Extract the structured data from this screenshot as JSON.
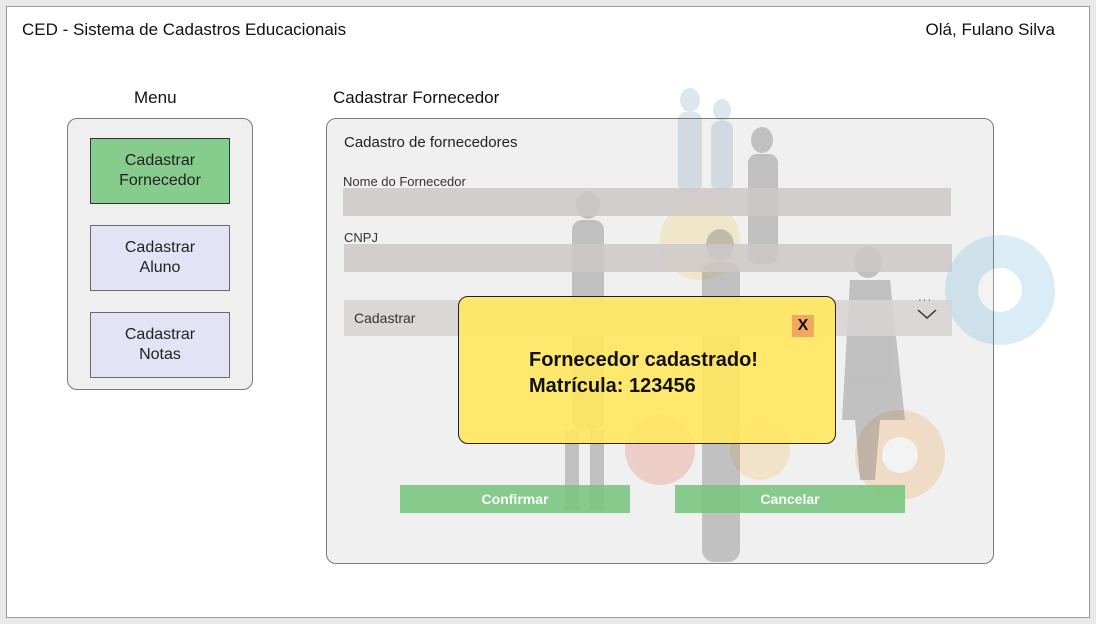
{
  "header": {
    "app_title": "CED - Sistema de Cadastros Educacionais",
    "greeting": "Olá, Fulano Silva"
  },
  "menu": {
    "heading": "Menu",
    "items": [
      {
        "label": "Cadastrar\nFornecedor",
        "active": true
      },
      {
        "label": "Cadastrar\nAluno",
        "active": false
      },
      {
        "label": "Cadastrar\nNotas",
        "active": false
      }
    ]
  },
  "main": {
    "heading": "Cadastrar Fornecedor",
    "form_title": "Cadastro de fornecedores",
    "fields": [
      {
        "label": "Nome do Fornecedor",
        "value": ""
      },
      {
        "label": "CNPJ",
        "value": ""
      }
    ],
    "select": {
      "value": "Cadastrar"
    },
    "confirm_label": "Confirmar",
    "cancel_label": "Cancelar"
  },
  "modal": {
    "line1": "Fornecedor cadastrado!",
    "line2": "Matrícula: 123456",
    "close_label": "X"
  },
  "colors": {
    "active_menu": "#86cc8c",
    "inactive_menu": "#e3e3f5",
    "action_button": "#7ac680",
    "modal_bg": "#ffe85f",
    "close_button": "#f0a860"
  }
}
